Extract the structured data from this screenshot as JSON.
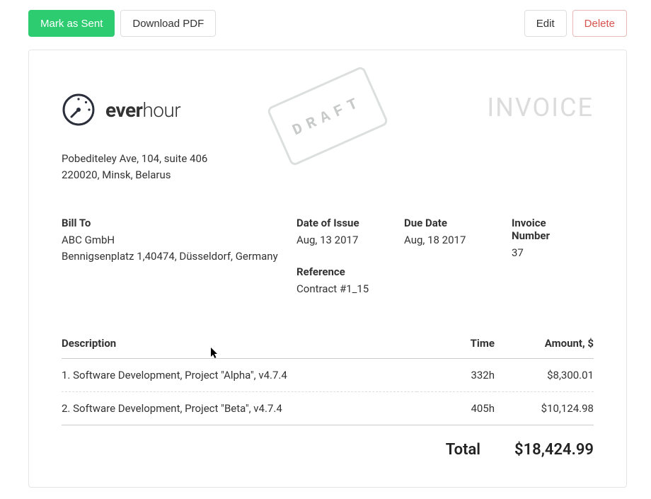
{
  "toolbar": {
    "mark_sent": "Mark as Sent",
    "download_pdf": "Download PDF",
    "edit": "Edit",
    "delete": "Delete"
  },
  "brand": {
    "bold": "ever",
    "light": "hour"
  },
  "invoice_title": "INVOICE",
  "draft_stamp": "DRAFT",
  "from": {
    "line1": "Pobediteley Ave, 104, suite 406",
    "line2": "220020, Minsk, Belarus"
  },
  "meta": {
    "bill_to_label": "Bill To",
    "bill_to_name": "ABC GmbH",
    "bill_to_address": "Bennigsenplatz 1,40474, Düsseldorf, Germany",
    "date_label": "Date of Issue",
    "date_value": "Aug, 13 2017",
    "due_label": "Due Date",
    "due_value": "Aug, 18 2017",
    "number_label": "Invoice Number",
    "number_value": "37",
    "reference_label": "Reference",
    "reference_value": "Contract #1_15"
  },
  "columns": {
    "desc": "Description",
    "time": "Time",
    "amount": "Amount, $"
  },
  "lines": [
    {
      "desc": "1. Software Development, Project \"Alpha\", v4.7.4",
      "time": "332h",
      "amount": "$8,300.01"
    },
    {
      "desc": "2. Software Development, Project \"Beta\", v4.7.4",
      "time": "405h",
      "amount": "$10,124.98"
    }
  ],
  "total": {
    "label": "Total",
    "value": "$18,424.99"
  }
}
